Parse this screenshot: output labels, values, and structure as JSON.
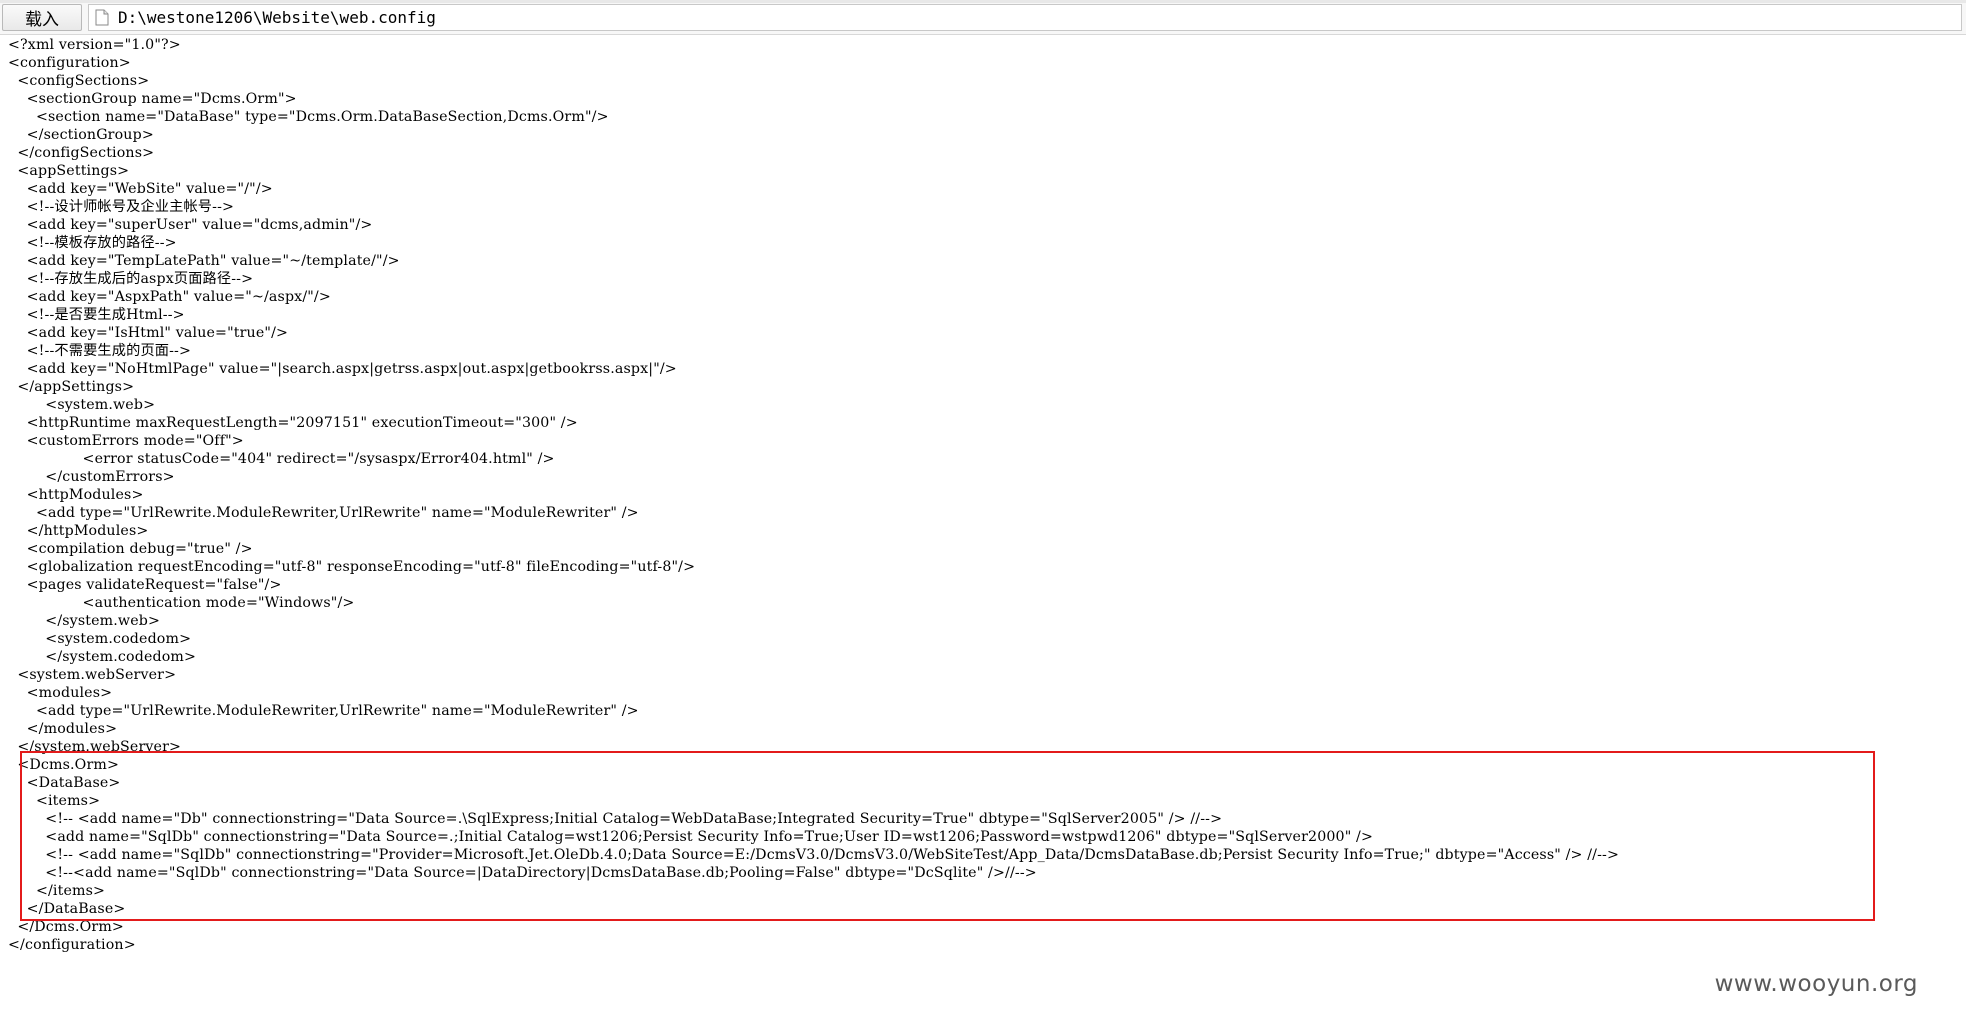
{
  "toolbar": {
    "load_button_label": "载入",
    "file_icon": "document-icon",
    "file_path": "D:\\westone1206\\Website\\web.config"
  },
  "code_lines": [
    "<?xml version=\"1.0\"?>",
    "<configuration>",
    "  <configSections>",
    "    <sectionGroup name=\"Dcms.Orm\">",
    "      <section name=\"DataBase\" type=\"Dcms.Orm.DataBaseSection,Dcms.Orm\"/>",
    "    </sectionGroup>",
    "  </configSections>",
    "  <appSettings>",
    "    <add key=\"WebSite\" value=\"/\"/>",
    "    <!--设计师帐号及企业主帐号-->",
    "    <add key=\"superUser\" value=\"dcms,admin\"/>",
    "    <!--模板存放的路径-->",
    "    <add key=\"TempLatePath\" value=\"~/template/\"/>",
    "    <!--存放生成后的aspx页面路径-->",
    "    <add key=\"AspxPath\" value=\"~/aspx/\"/>",
    "    <!--是否要生成Html-->",
    "    <add key=\"IsHtml\" value=\"true\"/>",
    "    <!--不需要生成的页面-->",
    "    <add key=\"NoHtmlPage\" value=\"|search.aspx|getrss.aspx|out.aspx|getbookrss.aspx|\"/>",
    "  </appSettings>",
    "        <system.web>",
    "    <httpRuntime maxRequestLength=\"2097151\" executionTimeout=\"300\" />",
    "    <customErrors mode=\"Off\">",
    "                <error statusCode=\"404\" redirect=\"/sysaspx/Error404.html\" />",
    "        </customErrors>",
    "    <httpModules>",
    "      <add type=\"UrlRewrite.ModuleRewriter,UrlRewrite\" name=\"ModuleRewriter\" />",
    "    </httpModules>",
    "    <compilation debug=\"true\" />",
    "    <globalization requestEncoding=\"utf-8\" responseEncoding=\"utf-8\" fileEncoding=\"utf-8\"/>",
    "    <pages validateRequest=\"false\"/>",
    "                <authentication mode=\"Windows\"/>",
    "        </system.web>",
    "        <system.codedom>",
    "        </system.codedom>",
    "  <system.webServer>",
    "    <modules>",
    "      <add type=\"UrlRewrite.ModuleRewriter,UrlRewrite\" name=\"ModuleRewriter\" />",
    "    </modules>",
    "  </system.webServer>",
    "  <Dcms.Orm>",
    "    <DataBase>",
    "      <items>",
    "        <!-- <add name=\"Db\" connectionstring=\"Data Source=.\\SqlExpress;Initial Catalog=WebDataBase;Integrated Security=True\" dbtype=\"SqlServer2005\" /> //-->",
    "        <add name=\"SqlDb\" connectionstring=\"Data Source=.;Initial Catalog=wst1206;Persist Security Info=True;User ID=wst1206;Password=wstpwd1206\" dbtype=\"SqlServer2000\" />",
    "        <!-- <add name=\"SqlDb\" connectionstring=\"Provider=Microsoft.Jet.OleDb.4.0;Data Source=E:/DcmsV3.0/DcmsV3.0/WebSiteTest/App_Data/DcmsDataBase.db;Persist Security Info=True;\" dbtype=\"Access\" /> //-->",
    "        <!--<add name=\"SqlDb\" connectionstring=\"Data Source=|DataDirectory|DcmsDataBase.db;Pooling=False\" dbtype=\"DcSqlite\" />//-->",
    "      </items>",
    "    </DataBase>",
    "  </Dcms.Orm>",
    "</configuration>"
  ],
  "highlight": {
    "color": "#e31b1b"
  },
  "watermark": "www.wooyun.org"
}
